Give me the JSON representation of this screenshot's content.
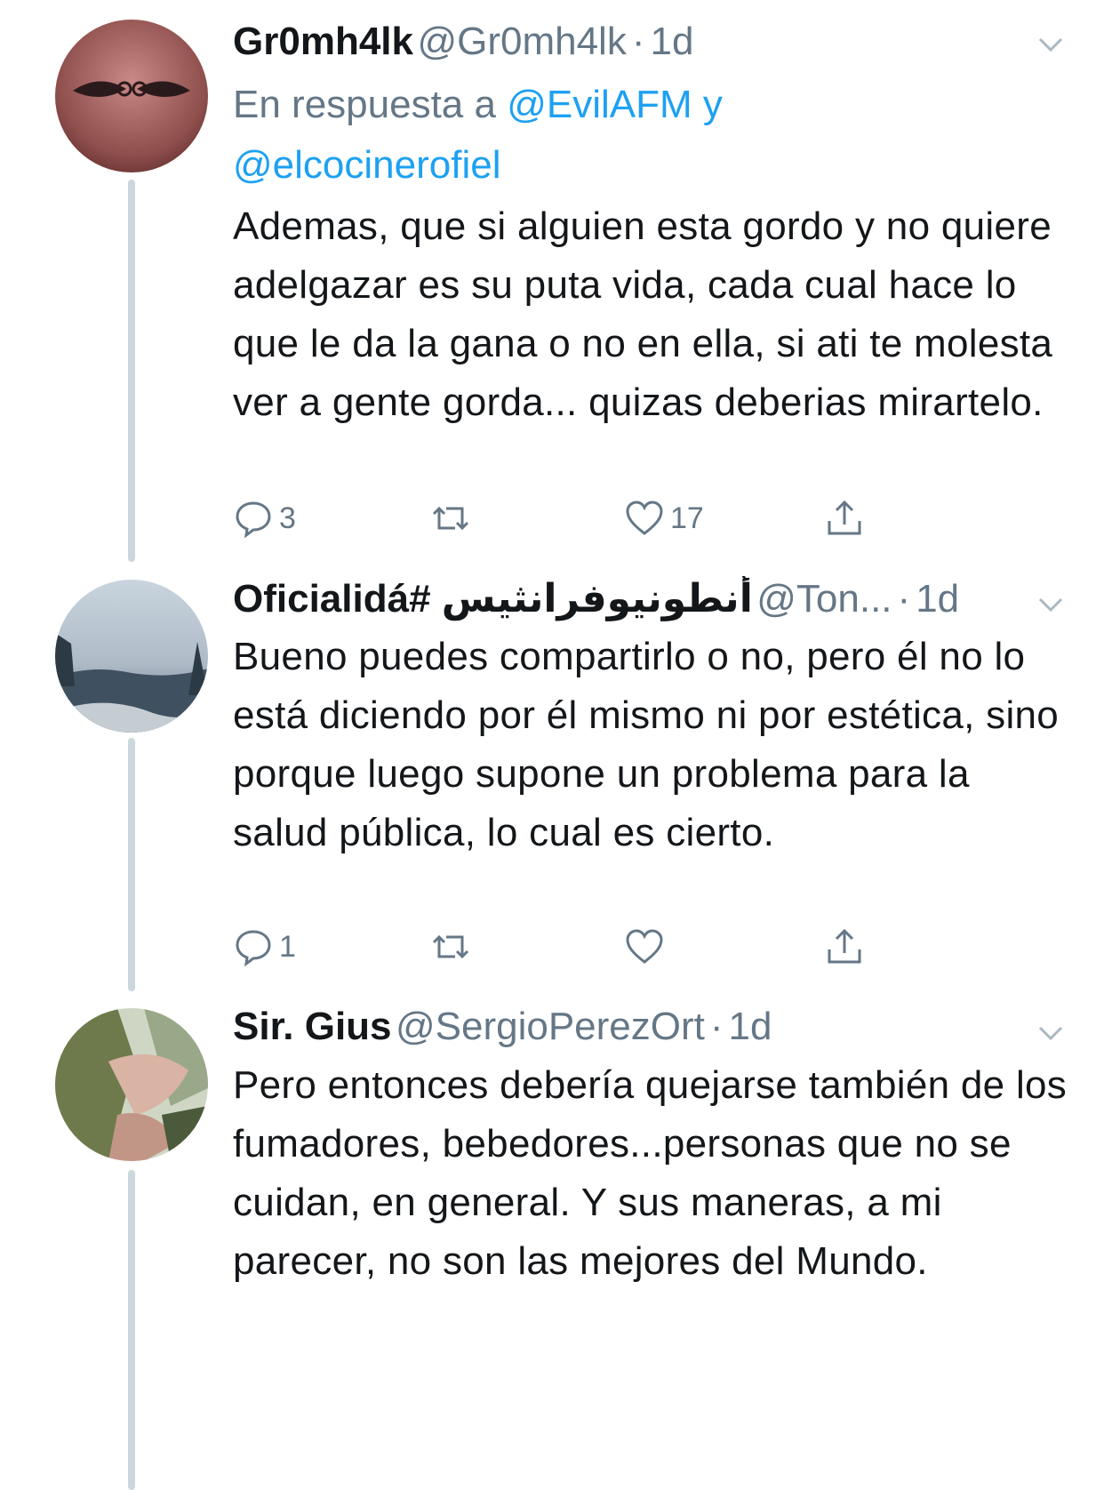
{
  "tweets": [
    {
      "name": "Gr0mh4lk",
      "handle": "@Gr0mh4lk",
      "time": "1d",
      "reply_prefix": "En respuesta a",
      "reply_user1": "@EvilAFM",
      "reply_joiner": "y",
      "reply_user2": "@elcocinerofiel",
      "text": "Ademas, que si alguien esta gordo y no quiere adelgazar es su puta vida, cada cual hace lo que le da la gana o no en ella, si ati te molesta ver a gente gorda... quizas deberias mirartelo.",
      "reply_count": "3",
      "like_count": "17"
    },
    {
      "name": "Oficialidá# أنطونيوفرانثيس",
      "handle": "@Ton...",
      "time": "1d",
      "text": "Bueno puedes compartirlo o no, pero él no lo está diciendo por él mismo ni por estética, sino porque luego supone un problema para la salud pública, lo cual es cierto.",
      "reply_count": "1",
      "like_count": ""
    },
    {
      "name": "Sir. Gius",
      "handle": "@SergioPerezOrt",
      "time": "1d",
      "text": "Pero entonces debería quejarse también de los fumadores, bebedores...personas que no se cuidan, en general. Y sus maneras, a mi parecer, no son las mejores del Mundo."
    }
  ],
  "separator": "·",
  "colors": {
    "link": "#1da1f2",
    "secondary": "#657786",
    "thread_line": "#ccd6dd"
  },
  "icons": [
    "reply-icon",
    "retweet-icon",
    "like-icon",
    "share-icon",
    "chevron-down-icon"
  ]
}
